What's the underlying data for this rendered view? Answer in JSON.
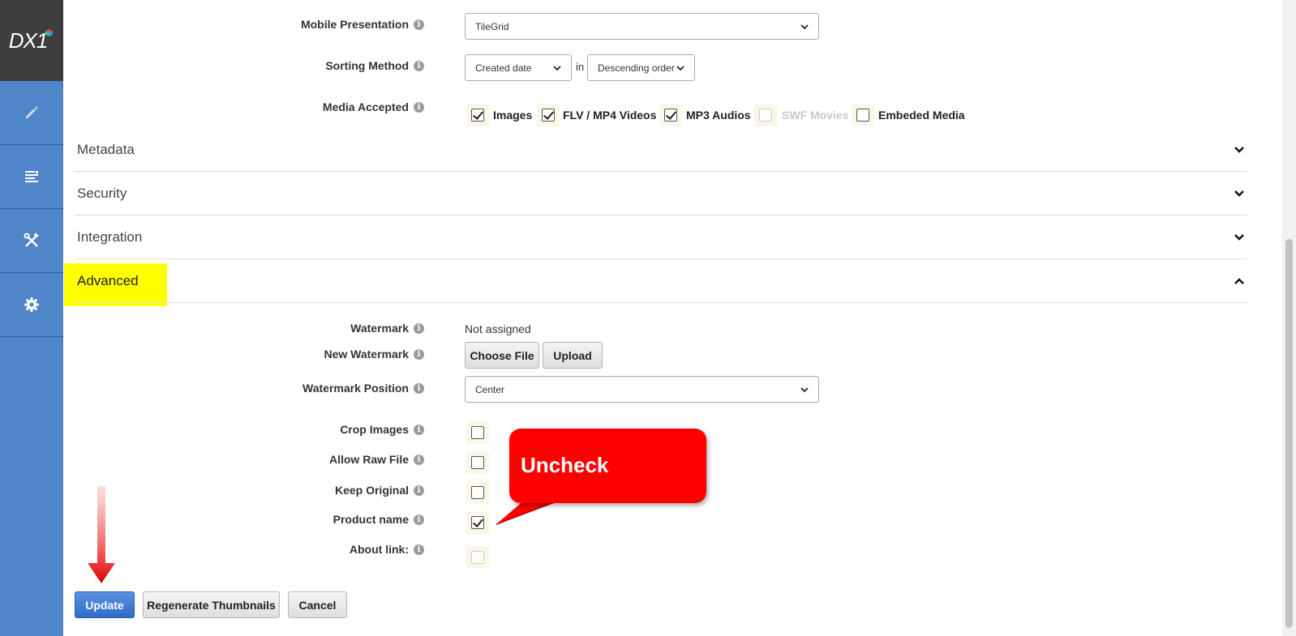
{
  "app": {
    "logo_text": "DX1"
  },
  "sidebar": {
    "items": [
      {
        "name": "edit",
        "icon": "pencil-icon"
      },
      {
        "name": "content",
        "icon": "document-list-icon"
      },
      {
        "name": "tools",
        "icon": "tools-icon"
      },
      {
        "name": "settings",
        "icon": "gear-icon"
      }
    ]
  },
  "form": {
    "mobile_presentation": {
      "label": "Mobile Presentation",
      "value": "TileGrid"
    },
    "sorting_method": {
      "label": "Sorting Method",
      "value": "Created date",
      "joiner": "in",
      "order": "Descending order"
    },
    "media_accepted": {
      "label": "Media Accepted",
      "options": [
        {
          "label": "Images",
          "checked": true,
          "disabled": false
        },
        {
          "label": "FLV / MP4 Videos",
          "checked": true,
          "disabled": false
        },
        {
          "label": "MP3 Audios",
          "checked": true,
          "disabled": false
        },
        {
          "label": "SWF Movies",
          "checked": false,
          "disabled": true
        },
        {
          "label": "Embeded Media",
          "checked": false,
          "disabled": false
        }
      ]
    }
  },
  "sections": [
    {
      "title": "Metadata",
      "expanded": false
    },
    {
      "title": "Security",
      "expanded": false
    },
    {
      "title": "Integration",
      "expanded": false
    },
    {
      "title": "Advanced",
      "expanded": true
    }
  ],
  "advanced": {
    "watermark": {
      "label": "Watermark",
      "value": "Not assigned"
    },
    "new_watermark": {
      "label": "New Watermark",
      "choose_label": "Choose File",
      "upload_label": "Upload"
    },
    "watermark_position": {
      "label": "Watermark Position",
      "value": "Center"
    },
    "crop_images": {
      "label": "Crop Images",
      "checked": false
    },
    "allow_raw_file": {
      "label": "Allow Raw File",
      "checked": false
    },
    "keep_original": {
      "label": "Keep Original",
      "checked": false
    },
    "product_name": {
      "label": "Product name",
      "checked": true
    },
    "about_link": {
      "label": "About link:",
      "checked": false,
      "disabled": true
    }
  },
  "actions": {
    "update": "Update",
    "regenerate": "Regenerate Thumbnails",
    "cancel": "Cancel"
  },
  "annotation": {
    "callout_text": "Uncheck"
  },
  "colors": {
    "sidebar": "#4f85c9",
    "logo_bg": "#3d3d3d",
    "highlight": "#ffff00",
    "callout": "#ff0000",
    "primary": "#2f6bc7"
  }
}
